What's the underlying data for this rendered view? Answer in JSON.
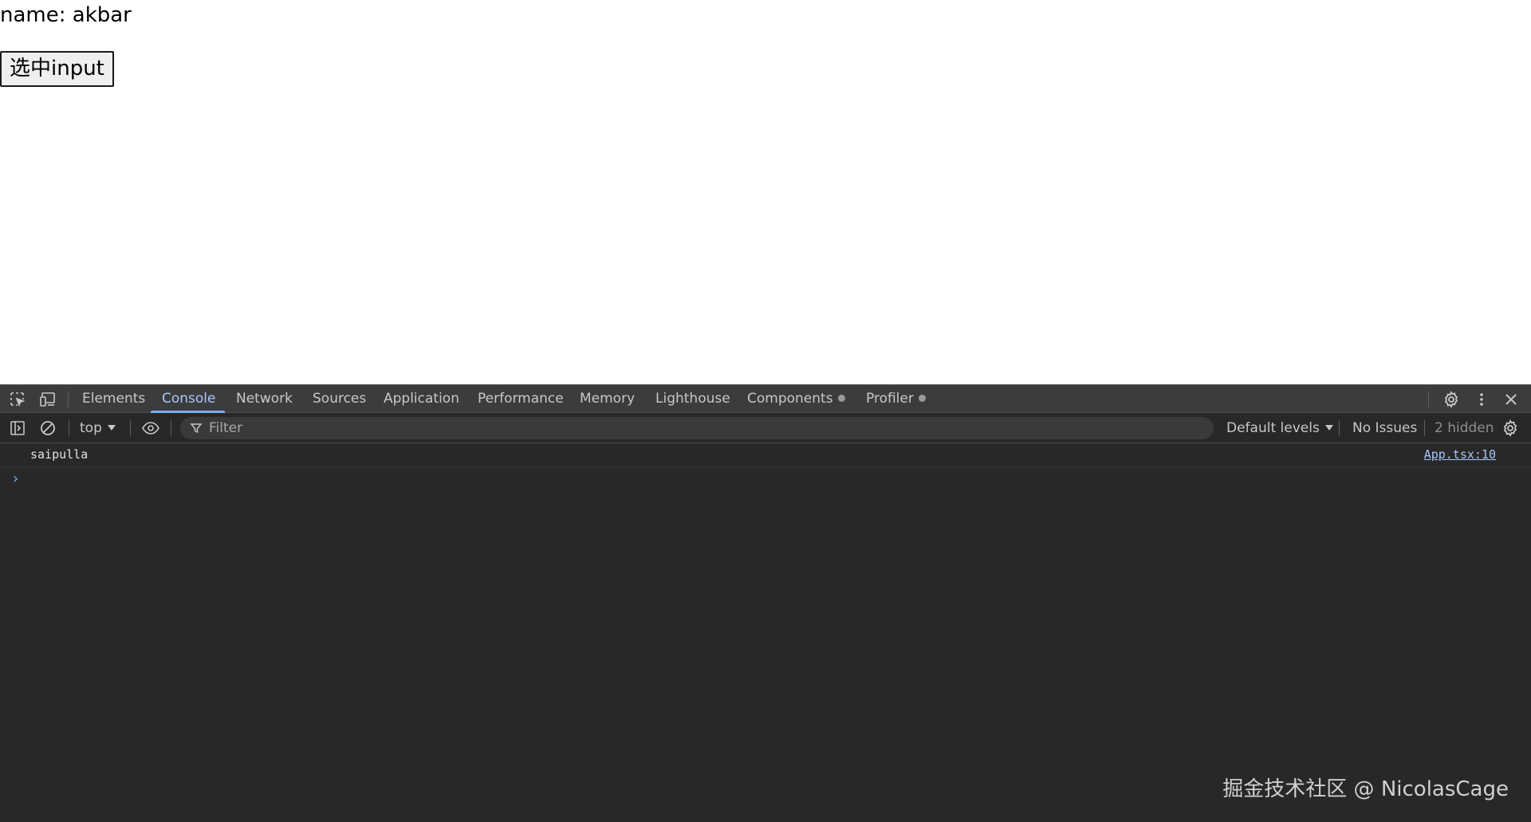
{
  "page": {
    "name_text": "name: akbar",
    "button_label": "选中input"
  },
  "devtools": {
    "tabs": [
      {
        "label": "Elements"
      },
      {
        "label": "Console",
        "active": true
      },
      {
        "label": "Network"
      },
      {
        "label": "Sources"
      },
      {
        "label": "Application"
      },
      {
        "label": "Performance"
      },
      {
        "label": "Memory"
      },
      {
        "label": "Lighthouse"
      },
      {
        "label": "Components"
      },
      {
        "label": "Profiler"
      }
    ],
    "toolbar": {
      "context": "top",
      "filter_placeholder": "Filter",
      "levels": "Default levels",
      "issues": "No Issues",
      "hidden": "2 hidden"
    },
    "console": {
      "messages": [
        {
          "text": "saipulla",
          "source": "App.tsx:10"
        }
      ],
      "prompt": "›"
    },
    "icons": {
      "inspect": "inspect-element-icon",
      "device": "device-toggle-icon",
      "settings": "gear-icon",
      "more": "kebab-menu-icon",
      "close": "close-icon",
      "sidebar": "sidebar-toggle-icon",
      "clear": "clear-console-icon",
      "eye": "live-expression-eye-icon",
      "filter": "filter-funnel-icon",
      "console_settings": "console-settings-gear-icon"
    },
    "colors": {
      "accent": "#7cacf8",
      "active_tab_text": "#a8c7fa",
      "panel_bg": "#282828",
      "tabbar_bg": "#3c3c3c"
    }
  },
  "watermark": "掘金技术社区 @ NicolasCage"
}
